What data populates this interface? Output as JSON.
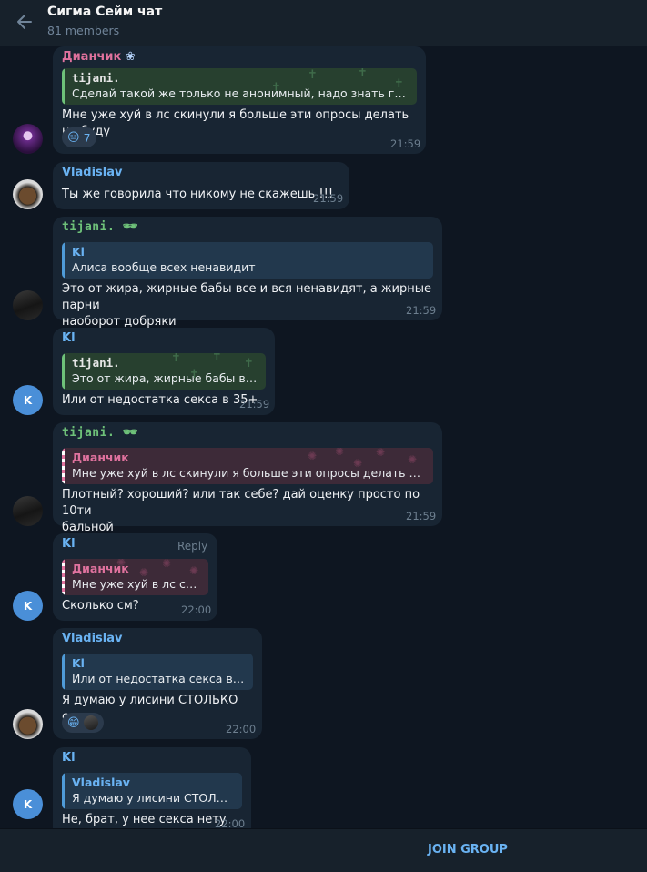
{
  "header": {
    "title": "Сигма Сейм чат",
    "subtitle": "81 members"
  },
  "colors": {
    "background": "#0e1621",
    "bubble": "#182533",
    "accent": "#6ab3f3",
    "name_green": "#6ec179",
    "name_pink": "#e0729e"
  },
  "messages": [
    {
      "sender": "Дианчик",
      "sender_emoji": "❀",
      "quote": {
        "name": "tijani.",
        "text": "Сделай такой же только не анонимный, надо знать герое..."
      },
      "text": "Мне уже хуй в лс скинули я больше эти опросы делать не буду",
      "reaction": {
        "emoji": "😑",
        "count": "7"
      },
      "time": "21:59"
    },
    {
      "sender": "Vladislav",
      "text": "Ты же говорила что никому не скажешь !!!",
      "time": "21:59"
    },
    {
      "sender": "tijani.",
      "sender_emoji": "🕶",
      "quote": {
        "name": "Kl",
        "text": "Алиса вообще всех ненавидит"
      },
      "text_lines": [
        "Это от жира, жирные бабы все и вся ненавидят, а жирные парни",
        "наоборот добряки"
      ],
      "time": "21:59"
    },
    {
      "sender": "Kl",
      "quote": {
        "name": "tijani.",
        "text": "Это от жира, жирные бабы все ..."
      },
      "text": "Или от недостатка секса в 35+",
      "time": "21:59"
    },
    {
      "sender": "tijani.",
      "sender_emoji": "🕶",
      "quote": {
        "name": "Дианчик",
        "text": "Мне уже хуй в лс скинули я больше эти опросы делать не буду"
      },
      "text_lines": [
        "Плотный? хороший? или так себе? дай оценку просто по 10ти",
        "бальной"
      ],
      "time": "21:59"
    },
    {
      "sender": "Kl",
      "reply_label": "Reply",
      "quote": {
        "name": "Дианчик",
        "text": "Мне уже хуй в лс ски..."
      },
      "text": "Сколько см?",
      "time": "22:00"
    },
    {
      "sender": "Vladislav",
      "quote": {
        "name": "Kl",
        "text": "Или от недостатка секса в 35+"
      },
      "text": "Я думаю у лисини СТОЛЬКО секса",
      "reaction": {
        "emoji": "😁"
      },
      "time": "22:00"
    },
    {
      "sender": "Kl",
      "quote": {
        "name": "Vladislav",
        "text": "Я думаю у лисини СТОЛЬК..."
      },
      "text": "Не, брат, у нее секса нету",
      "time": "22:00"
    }
  ],
  "avatars": {
    "k_letter": "K"
  },
  "footer": {
    "join_label": "JOIN GROUP"
  }
}
